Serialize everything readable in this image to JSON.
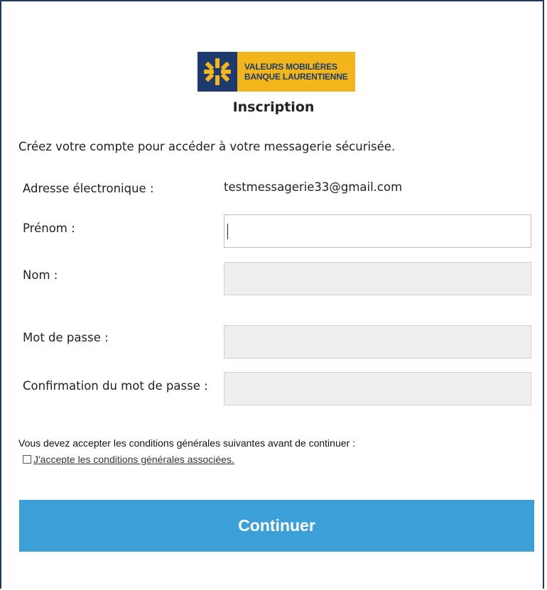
{
  "logo": {
    "line1": "VALEURS MOBILIÈRES",
    "line2": "BANQUE LAURENTIENNE",
    "colors": {
      "mark": "#1d3a6e",
      "band": "#f2b61c"
    }
  },
  "page": {
    "title": "Inscription",
    "intro": "Créez votre compte pour accéder à votre messagerie sécurisée."
  },
  "form": {
    "email_label": "Adresse électronique :",
    "email_value": "testmessagerie33@gmail.com",
    "first_name_label": "Prénom :",
    "first_name_value": "",
    "last_name_label": "Nom :",
    "last_name_value": "",
    "password_label": "Mot de passe :",
    "password_value": "",
    "confirm_label": "Confirmation du mot de passe :",
    "confirm_value": ""
  },
  "terms": {
    "notice": "Vous devez accepter les conditions générales suivantes avant de continuer :",
    "accept_link": "J'accepte les conditions générales associées.",
    "checked": false
  },
  "actions": {
    "continue_label": "Continuer",
    "accent_color": "#3c9fd7"
  }
}
